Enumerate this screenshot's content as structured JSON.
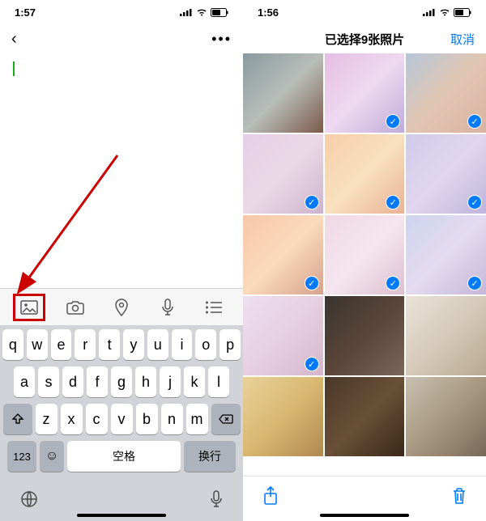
{
  "left": {
    "status": {
      "time": "1:57"
    },
    "toolbar": {
      "items": [
        "image-icon",
        "camera-icon",
        "location-icon",
        "mic-icon",
        "list-icon"
      ]
    },
    "keyboard": {
      "row1": [
        "q",
        "w",
        "e",
        "r",
        "t",
        "y",
        "u",
        "i",
        "o",
        "p"
      ],
      "row2": [
        "a",
        "s",
        "d",
        "f",
        "g",
        "h",
        "j",
        "k",
        "l"
      ],
      "row3": [
        "z",
        "x",
        "c",
        "v",
        "b",
        "n",
        "m"
      ],
      "numKey": "123",
      "space": "空格",
      "return": "换行"
    }
  },
  "right": {
    "status": {
      "time": "1:56"
    },
    "nav": {
      "title": "已选择9张照片",
      "cancel": "取消"
    },
    "photos": [
      {
        "selected": false,
        "colors": [
          "#8a9a9f",
          "#b8bdb9",
          "#7c5a4a"
        ]
      },
      {
        "selected": true,
        "colors": [
          "#d89bd4",
          "#e5c5e8",
          "#9b7ec5"
        ]
      },
      {
        "selected": true,
        "colors": [
          "#8fa8c4",
          "#d2a88a",
          "#c48970"
        ]
      },
      {
        "selected": true,
        "colors": [
          "#d9b5dc",
          "#e0c4d6",
          "#b18ab3"
        ]
      },
      {
        "selected": true,
        "colors": [
          "#f2b57a",
          "#f4d09c",
          "#dc8a5e"
        ]
      },
      {
        "selected": true,
        "colors": [
          "#b8b0e0",
          "#d0c0e5",
          "#9c8dc8"
        ]
      },
      {
        "selected": true,
        "colors": [
          "#f5a87c",
          "#f7c798",
          "#c07050"
        ]
      },
      {
        "selected": true,
        "colors": [
          "#e6c5d5",
          "#f0d8e5",
          "#c89db8"
        ]
      },
      {
        "selected": true,
        "colors": [
          "#b5bce5",
          "#d5c8e8",
          "#a590c5"
        ]
      },
      {
        "selected": true,
        "colors": [
          "#e5d0e5",
          "#d8b5d0",
          "#c08fb0"
        ]
      },
      {
        "selected": false,
        "colors": [
          "#3a3530",
          "#5a4538",
          "#7a685a"
        ]
      },
      {
        "selected": false,
        "colors": [
          "#e8e2d8",
          "#d5cab8",
          "#b8a890"
        ]
      },
      {
        "selected": false,
        "colors": [
          "#e8d29a",
          "#d8b870",
          "#b08850"
        ]
      },
      {
        "selected": false,
        "colors": [
          "#4a3828",
          "#6a5038",
          "#3a2818"
        ]
      },
      {
        "selected": false,
        "colors": [
          "#c8c0b0",
          "#a89880",
          "#786858"
        ]
      }
    ]
  }
}
